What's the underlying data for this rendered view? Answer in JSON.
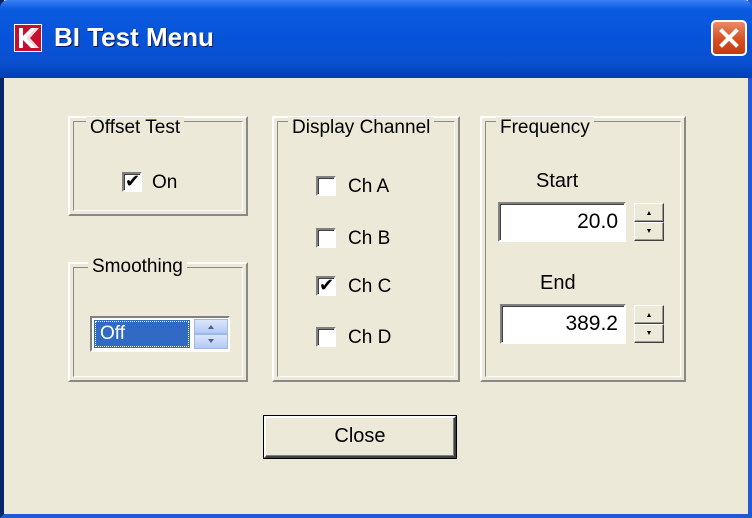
{
  "window": {
    "title": "BI Test Menu",
    "app_icon": "k-logo-icon",
    "close_icon": "close-x-icon"
  },
  "offset_test": {
    "group_title": "Offset Test",
    "checkbox": {
      "label": "On",
      "checked": true
    }
  },
  "smoothing": {
    "group_title": "Smoothing",
    "value": "Off"
  },
  "display_channel": {
    "group_title": "Display Channel",
    "channels": [
      {
        "label": "Ch A",
        "checked": false
      },
      {
        "label": "Ch B",
        "checked": false
      },
      {
        "label": "Ch C",
        "checked": true
      },
      {
        "label": "Ch D",
        "checked": false
      }
    ]
  },
  "frequency": {
    "group_title": "Frequency",
    "start": {
      "label": "Start",
      "value": "20.0"
    },
    "end": {
      "label": "End",
      "value": "389.2"
    }
  },
  "close_button": {
    "label": "Close"
  },
  "colors": {
    "titlebar": "#0653d9",
    "face": "#ece9d8",
    "close_button": "#d84e20",
    "selection": "#316ac5"
  }
}
